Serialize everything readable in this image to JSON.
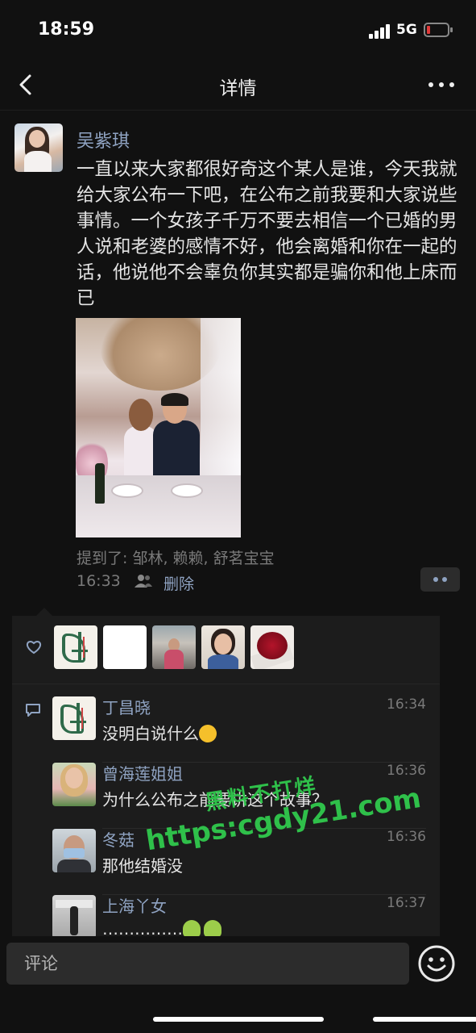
{
  "status_bar": {
    "time": "18:59",
    "network": "5G"
  },
  "nav": {
    "title": "详情"
  },
  "post": {
    "author": "吴紫琪",
    "text": "一直以来大家都很好奇这个某人是谁，今天我就给大家公布一下吧，在公布之前我要和大家说些事情。一个女孩子千万不要去相信一个已婚的男人说和老婆的感情不好，他会离婚和你在一起的话，他说他不会辜负你其实都是骗你和他上床而已",
    "mentions": "提到了: 邹林, 赖赖, 舒茗宝宝",
    "time": "16:33",
    "delete_label": "删除"
  },
  "likes": {
    "count_shown": 5
  },
  "comments": [
    {
      "name": "丁昌晓",
      "time": "16:34",
      "text": "没明白说什么"
    },
    {
      "name": "曾海莲姐姐",
      "time": "16:36",
      "text": "为什么公布之前要讲这个故事？"
    },
    {
      "name": "冬菇",
      "time": "16:36",
      "text": "那他结婚没"
    },
    {
      "name": "上海丫女",
      "time": "16:37",
      "text": "……………"
    }
  ],
  "watermark": {
    "line1": "黑料不打烊",
    "line2": "https:cgdy21.com"
  },
  "input": {
    "placeholder": "评论"
  },
  "colors": {
    "accent_link": "#8fa3c2",
    "background": "#111111",
    "watermark": "#2fc04a"
  }
}
